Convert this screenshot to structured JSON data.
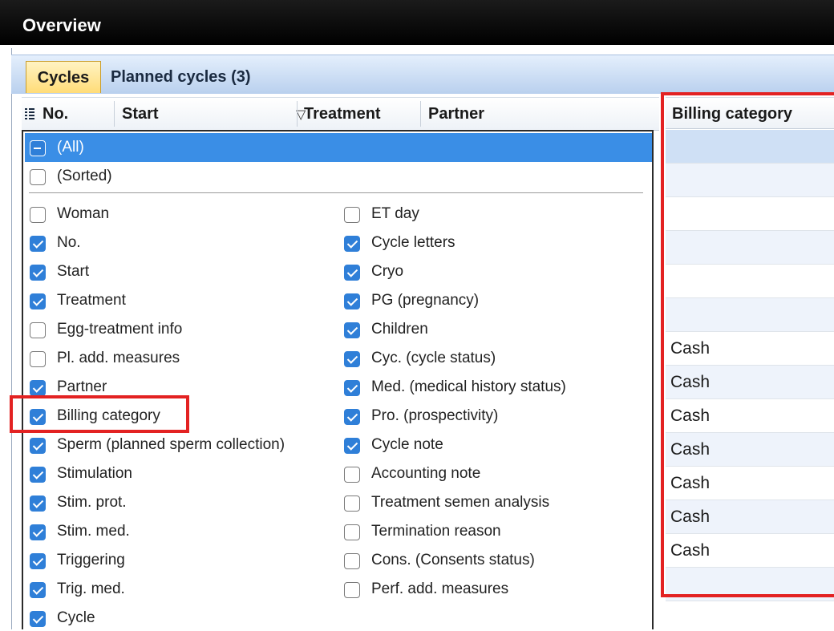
{
  "window": {
    "title": "Overview"
  },
  "tabs": [
    {
      "label": "Cycles",
      "active": true
    },
    {
      "label": "Planned cycles (3)",
      "active": false
    }
  ],
  "columns": {
    "no": "No.",
    "start": "Start",
    "treatment": "Treatment",
    "partner": "Partner",
    "billing": "Billing category"
  },
  "filter_popup": {
    "all_label": "(All)",
    "sorted_label": "(Sorted)",
    "left_items": [
      {
        "label": "Woman",
        "checked": false
      },
      {
        "label": "No.",
        "checked": true
      },
      {
        "label": "Start",
        "checked": true
      },
      {
        "label": "Treatment",
        "checked": true
      },
      {
        "label": "Egg-treatment info",
        "checked": false
      },
      {
        "label": "Pl. add. measures",
        "checked": false
      },
      {
        "label": "Partner",
        "checked": true
      },
      {
        "label": "Billing category",
        "checked": true
      },
      {
        "label": "Sperm (planned sperm collection)",
        "checked": true
      },
      {
        "label": "Stimulation",
        "checked": true
      },
      {
        "label": "Stim. prot.",
        "checked": true
      },
      {
        "label": "Stim. med.",
        "checked": true
      },
      {
        "label": "Triggering",
        "checked": true
      },
      {
        "label": "Trig. med.",
        "checked": true
      },
      {
        "label": "Cycle",
        "checked": true
      }
    ],
    "right_items": [
      {
        "label": "ET day",
        "checked": false
      },
      {
        "label": "Cycle letters",
        "checked": true
      },
      {
        "label": "Cryo",
        "checked": true
      },
      {
        "label": "PG (pregnancy)",
        "checked": true
      },
      {
        "label": "Children",
        "checked": true
      },
      {
        "label": "Cyc. (cycle status)",
        "checked": true
      },
      {
        "label": "Med. (medical history status)",
        "checked": true
      },
      {
        "label": "Pro. (prospectivity)",
        "checked": true
      },
      {
        "label": "Cycle note",
        "checked": true
      },
      {
        "label": "Accounting note",
        "checked": false
      },
      {
        "label": "Treatment semen analysis",
        "checked": false
      },
      {
        "label": "Termination reason",
        "checked": false
      },
      {
        "label": "Cons. (Consents status)",
        "checked": false
      },
      {
        "label": "Perf. add. measures",
        "checked": false
      }
    ]
  },
  "billing_column": {
    "values": [
      "",
      "",
      "",
      "",
      "",
      "",
      "Cash",
      "Cash",
      "Cash",
      "Cash",
      "Cash",
      "Cash",
      "Cash",
      ""
    ]
  },
  "colors": {
    "selection": "#3a8ee6",
    "checkbox": "#2f7fd8",
    "highlight": "#e32222",
    "stripe": "#eef3fb"
  }
}
